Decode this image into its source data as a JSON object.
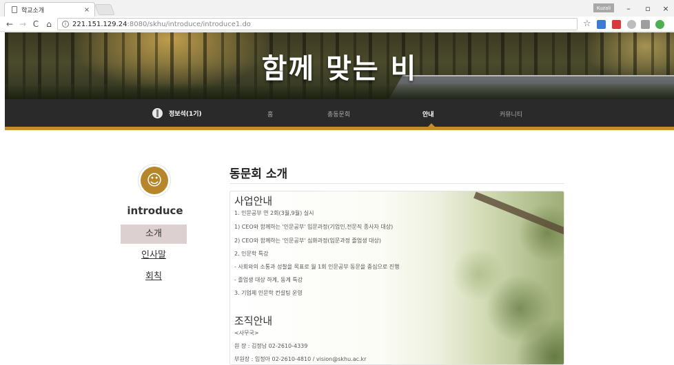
{
  "browser": {
    "tab_title": "학교소개",
    "tab_close": "×",
    "url_host": "221.151.129.24",
    "url_port": ":8080",
    "url_path": "/skhu/introduce/introduce1.do",
    "info_glyph": "i",
    "user_badge": "Kuzali",
    "win_min": "–",
    "win_max": "▫",
    "win_close": "×",
    "back": "←",
    "forward": "→",
    "reload": "C",
    "home": "⌂",
    "star": "☆"
  },
  "header": {
    "banner_title": "함께 맞는 비",
    "user_name": "정보석(1기)",
    "nav": [
      {
        "label": "홈"
      },
      {
        "label": "총동문회"
      },
      {
        "label": "안내"
      },
      {
        "label": "커뮤니티"
      }
    ]
  },
  "sidebar": {
    "avatar_glyph": "☺",
    "title": "introduce",
    "items": [
      {
        "label": "소개"
      },
      {
        "label": "인사말"
      },
      {
        "label": "회칙"
      }
    ]
  },
  "main": {
    "title": "동문회 소개",
    "business": {
      "heading": "사업안내",
      "lines": [
        "1. 인문공부 연 2회(3월,9월) 실시",
        "1) CEO와 함께하는 '인문공부' 입문과정(기업인,전문직 종사자 대상)",
        "2) CEO와 함께하는 '인문공부' 심화과정(입문과정 졸업생 대상)",
        "2. 인문학 특강",
        "- 사회와의 소통과 성찰을 목표로 월 1회 인문공부 동문을 중심으로 진행",
        "- 졸업생 대상 하계, 동계 특강",
        "3. 기업체 인문학 컨설팅 운영"
      ]
    },
    "organization": {
      "heading": "조직안내",
      "lines": [
        "<사무국>",
        "원 장 : 김정남 02-2610-4339",
        "부원장 : 임정아 02-2610-4810 / vision@skhu.ac.kr"
      ]
    }
  },
  "colors": {
    "accent": "#c58d2a",
    "nav_bg": "#2a2a2a",
    "sidebar_active": "#ddd0d0"
  }
}
